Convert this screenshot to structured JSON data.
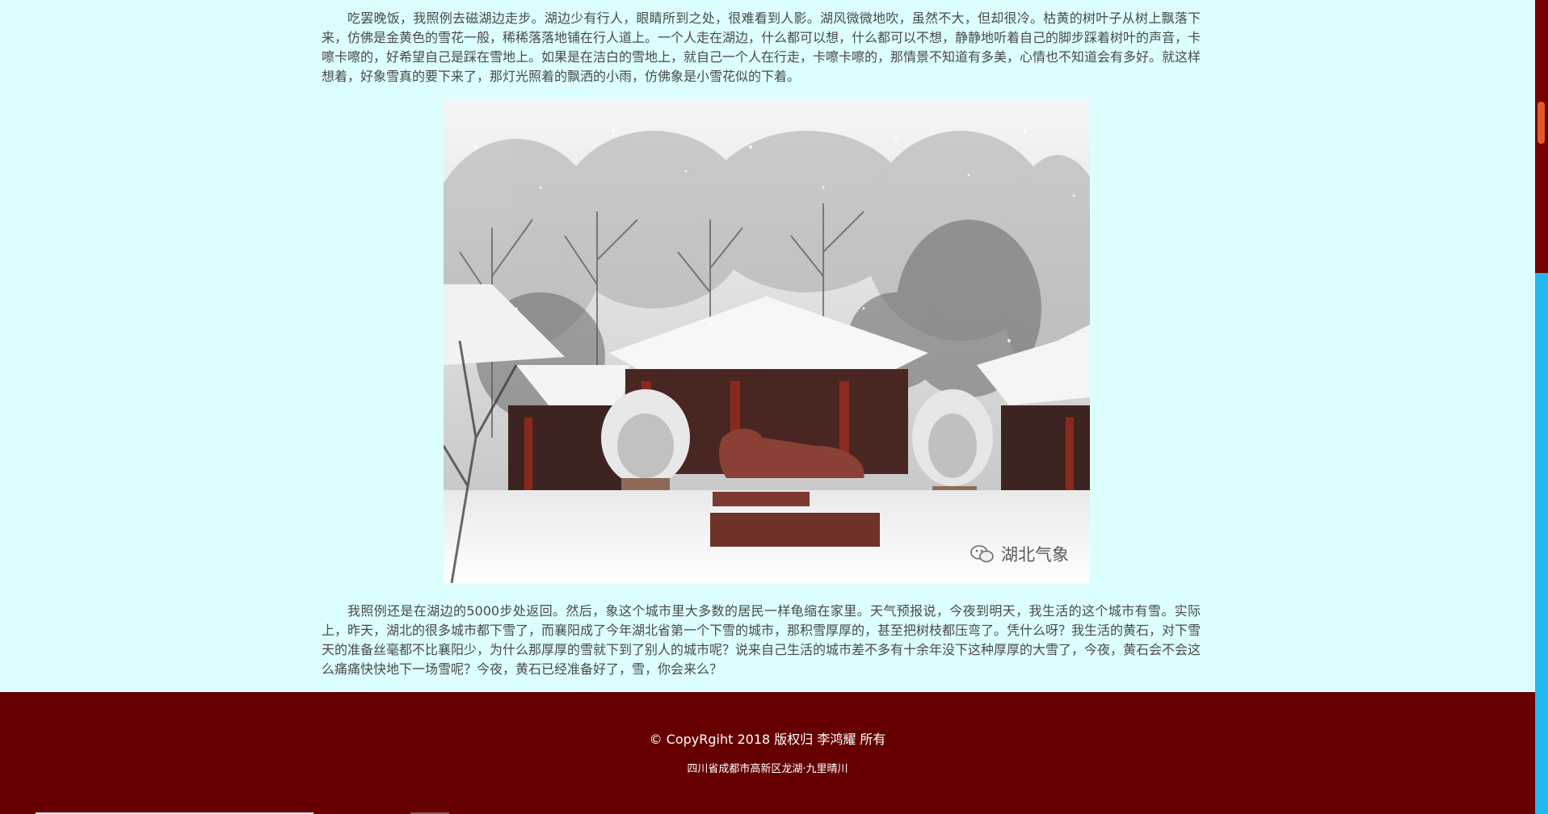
{
  "article": {
    "paragraph_1": "吃罢晚饭，我照例去磁湖边走步。湖边少有行人，眼睛所到之处，很难看到人影。湖风微微地吹，虽然不大，但却很冷。枯黄的树叶子从树上飘落下来，仿佛是金黄色的雪花一般，稀稀落落地铺在行人道上。一个人走在湖边，什么都可以想，什么都可以不想，静静地听着自己的脚步踩着树叶的声音，卡嚓卡嚓的，好希望自己是踩在雪地上。如果是在洁白的雪地上，就自己一个人在行走，卡嚓卡嚓的，那情景不知道有多美，心情也不知道会有多好。就这样想着，好象雪真的要下来了，那灯光照着的飘洒的小雨，仿佛象是小雪花似的下着。",
    "paragraph_2": "我照例还是在湖边的5000步处返回。然后，象这个城市里大多数的居民一样龟缩在家里。天气预报说，今夜到明天，我生活的这个城市有雪。实际上，昨天，湖北的很多城市都下雪了，而襄阳成了今年湖北省第一个下雪的城市，那积雪厚厚的，甚至把树枝都压弯了。凭什么呀？我生活的黄石，对下雪天的准备丝毫都不比襄阳少，为什么那厚厚的雪就下到了别人的城市呢？说来自己生活的城市差不多有十余年没下这种厚厚的大雪了，今夜，黄石会不会这么痛痛快快地下一场雪呢？今夜，黄石已经准备好了，雪，你会来么？",
    "photo": {
      "watermark_text": "湖北气象",
      "watermark_icon": "wechat-icon"
    }
  },
  "footer": {
    "copyright": "© CopyRgiht 2018 版权归 李鸿耀 所有",
    "address": "四川省成都市高新区龙湖·九里晴川"
  },
  "colors": {
    "page_background": "#dcfefe",
    "footer_background": "#660000",
    "text": "#4a4a4a",
    "scrollbar_track": "#770000",
    "scrollbar_lower": "#22b8f0",
    "scrollbar_thumb": "#e05a2a"
  }
}
